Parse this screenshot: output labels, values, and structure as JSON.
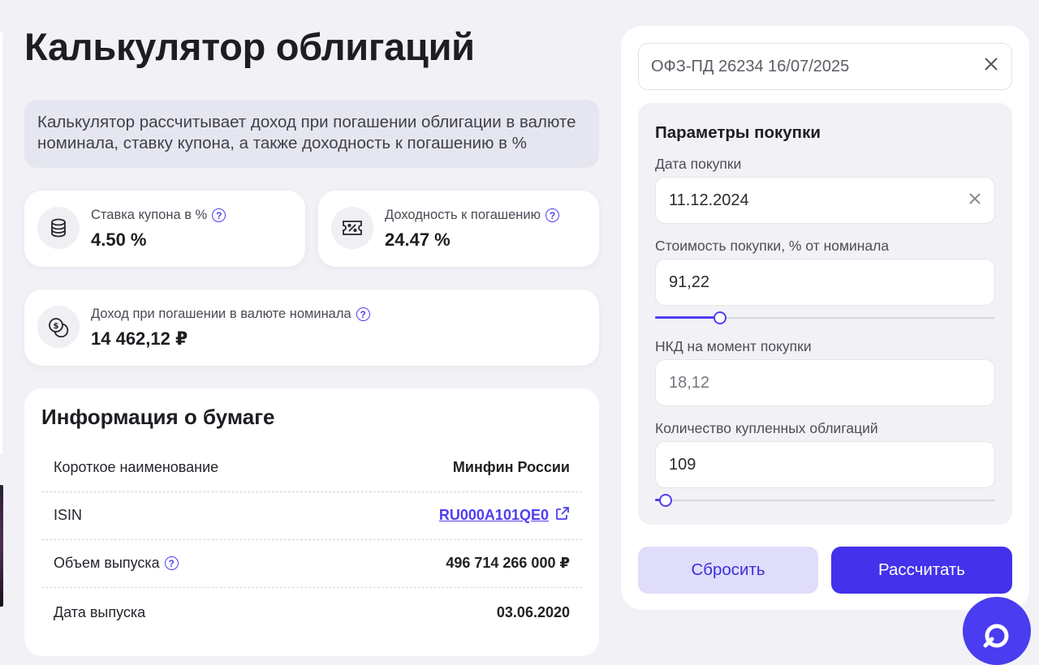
{
  "page_title": "Калькулятор облигаций",
  "description": "Калькулятор рассчитывает доход при погашении облигации в валюте номинала, ставку купона, а также доходность к погашению в %",
  "stats": {
    "coupon": {
      "label": "Ставка купона в %",
      "value": "4.50 %"
    },
    "yield": {
      "label": "Доходность к погашению",
      "value": "24.47 %"
    },
    "income": {
      "label": "Доход при погашении в валюте номинала",
      "value": "14 462,12 ₽"
    }
  },
  "info": {
    "title": "Информация о бумаге",
    "rows": [
      {
        "key": "Короткое наименование",
        "value": "Минфин России"
      },
      {
        "key": "ISIN",
        "value": "RU000A101QE0"
      },
      {
        "key": "Объем выпуска",
        "value": "496 714 266 000 ₽"
      },
      {
        "key": "Дата выпуска",
        "value": "03.06.2020"
      }
    ]
  },
  "panel": {
    "search_value": "ОФЗ-ПД 26234 16/07/2025",
    "params_title": "Параметры покупки",
    "purchase_date": {
      "label": "Дата покупки",
      "value": "11.12.2024"
    },
    "price": {
      "label": "Стоимость покупки, % от номинала",
      "value": "91,22",
      "slider_fraction": 0.19
    },
    "nkd": {
      "label": "НКД на момент покупки",
      "value": "18,12"
    },
    "quantity": {
      "label": "Количество купленных облигаций",
      "value": "109",
      "slider_fraction": 0.03
    },
    "reset_label": "Сбросить",
    "calc_label": "Рассчитать"
  },
  "colors": {
    "accent": "#4431eb",
    "background": "#f1f1f6",
    "description_bg": "#e6e6f1"
  },
  "icons": [
    "coins-icon",
    "ticket-percent-icon",
    "dollar-coins-icon",
    "help-icon",
    "close-icon",
    "external-link-icon",
    "chat-icon"
  ]
}
